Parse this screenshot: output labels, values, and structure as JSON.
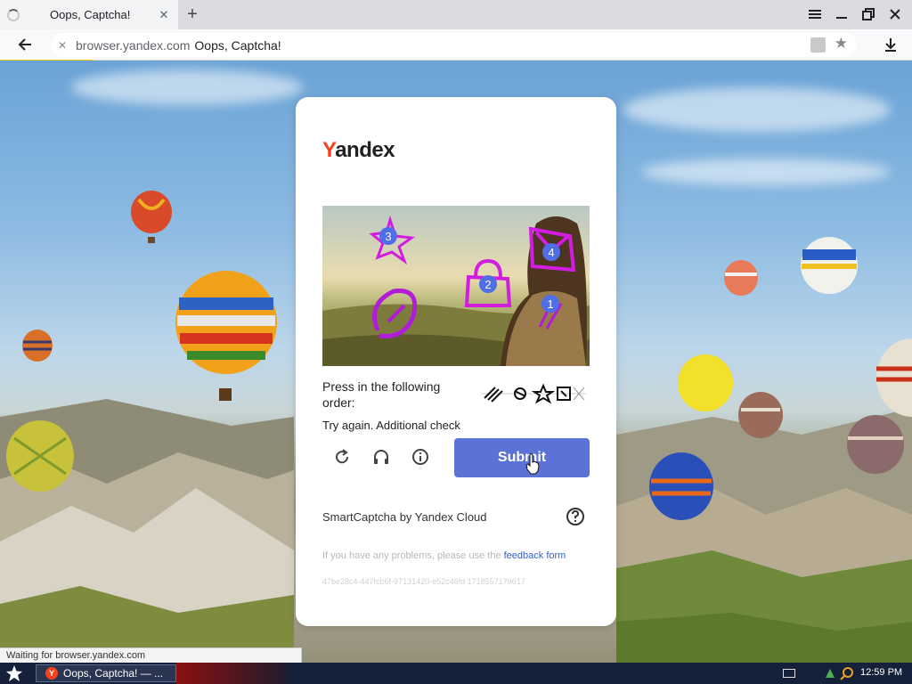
{
  "browser": {
    "tab_title": "Oops, Captcha!",
    "new_tab_symbol": "+",
    "url_host": "browser.yandex.com",
    "url_title": "Oops, Captcha!"
  },
  "captcha": {
    "logo_first": "Y",
    "logo_rest": "andex",
    "challenge_markers": [
      "3",
      "4",
      "2",
      "1"
    ],
    "instruction": "Press in the following order:",
    "status": "Try again. Additional check",
    "submit_label": "Submit",
    "branding": "SmartCaptcha by Yandex Cloud",
    "problems_text": "If you have any problems, please use the ",
    "feedback_link": "feedback form",
    "request_id": "47be28c4-447fcb6f-97131420-e52c46fd 1718557179617"
  },
  "status_bar": {
    "text": "Waiting for browser.yandex.com"
  },
  "taskbar": {
    "task_label": "Oops, Captcha! — ...",
    "task_icon": "Y",
    "clock": "12:59 PM"
  },
  "colors": {
    "brand_red": "#fc3f1d",
    "submit_blue": "#5b73d6",
    "link_blue": "#2e5fcf",
    "marker_blue": "#4f6ee8",
    "marker_stroke": "#d21ce0"
  },
  "icons": {
    "refresh": "refresh-icon",
    "audio": "headphones-icon",
    "info": "info-icon",
    "help": "question-icon",
    "menu": "hamburger-icon",
    "star": "star-icon",
    "download": "download-icon"
  }
}
